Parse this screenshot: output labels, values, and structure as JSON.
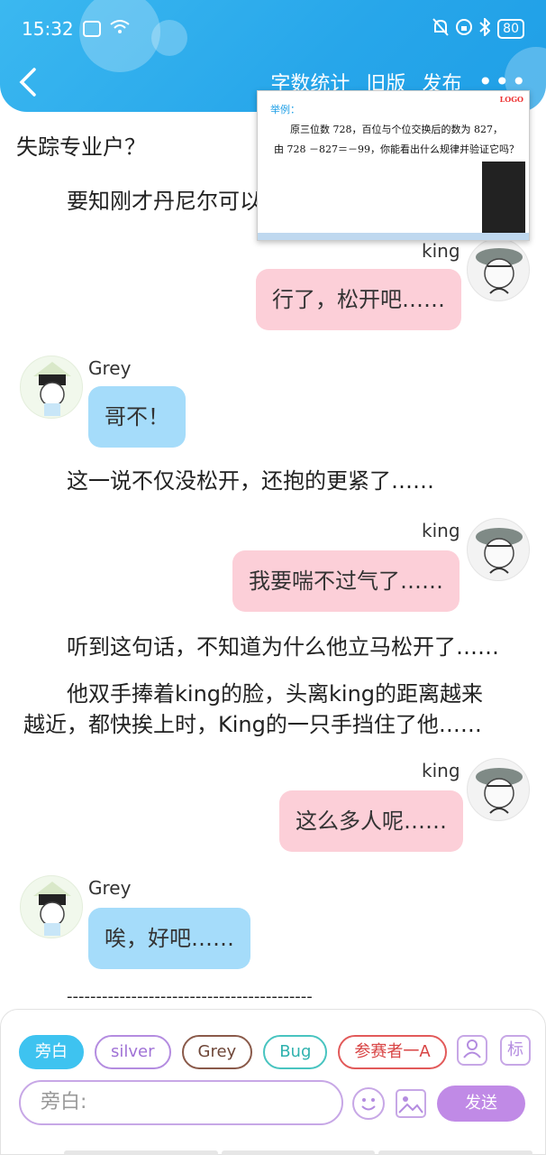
{
  "status": {
    "time": "15:32",
    "battery": "80"
  },
  "header": {
    "actions": [
      "字数统计",
      "旧版",
      "发布"
    ]
  },
  "overlay": {
    "title": "举例：",
    "line1": "原三位数 728，百位与个位交换后的数为 827，",
    "line2": "由 728 －827＝－99，你能看出什么规律并验证它吗？"
  },
  "chat": {
    "narr1": "失踪专业户？",
    "narr2": "要知刚才丹尼尔可以",
    "king_name": "king",
    "grey_name": "Grey",
    "msg1": "行了，松开吧……",
    "msg2": "哥不！",
    "narr3": "这一说不仅没松开，还抱的更紧了……",
    "msg3": "我要喘不过气了……",
    "narr4": "听到这句话，不知道为什么他立马松开了……",
    "narr5_a": "他双手捧着king的脸，头离king的距离越来",
    "narr5_b": "越近，都快挨上时，King的一只手挡住了他……",
    "msg4": "这么多人呢……",
    "msg5": "唉，好吧……",
    "divider": "------------------------------------------"
  },
  "panel": {
    "chips": [
      "旁白",
      "silver",
      "Grey",
      "Bug",
      "参赛者一A"
    ],
    "side_icon": "标",
    "input_placeholder": "旁白:",
    "send": "发送"
  },
  "icons": [
    "back-icon",
    "more-icon",
    "avatar-icon",
    "emoji-icon",
    "image-icon"
  ]
}
